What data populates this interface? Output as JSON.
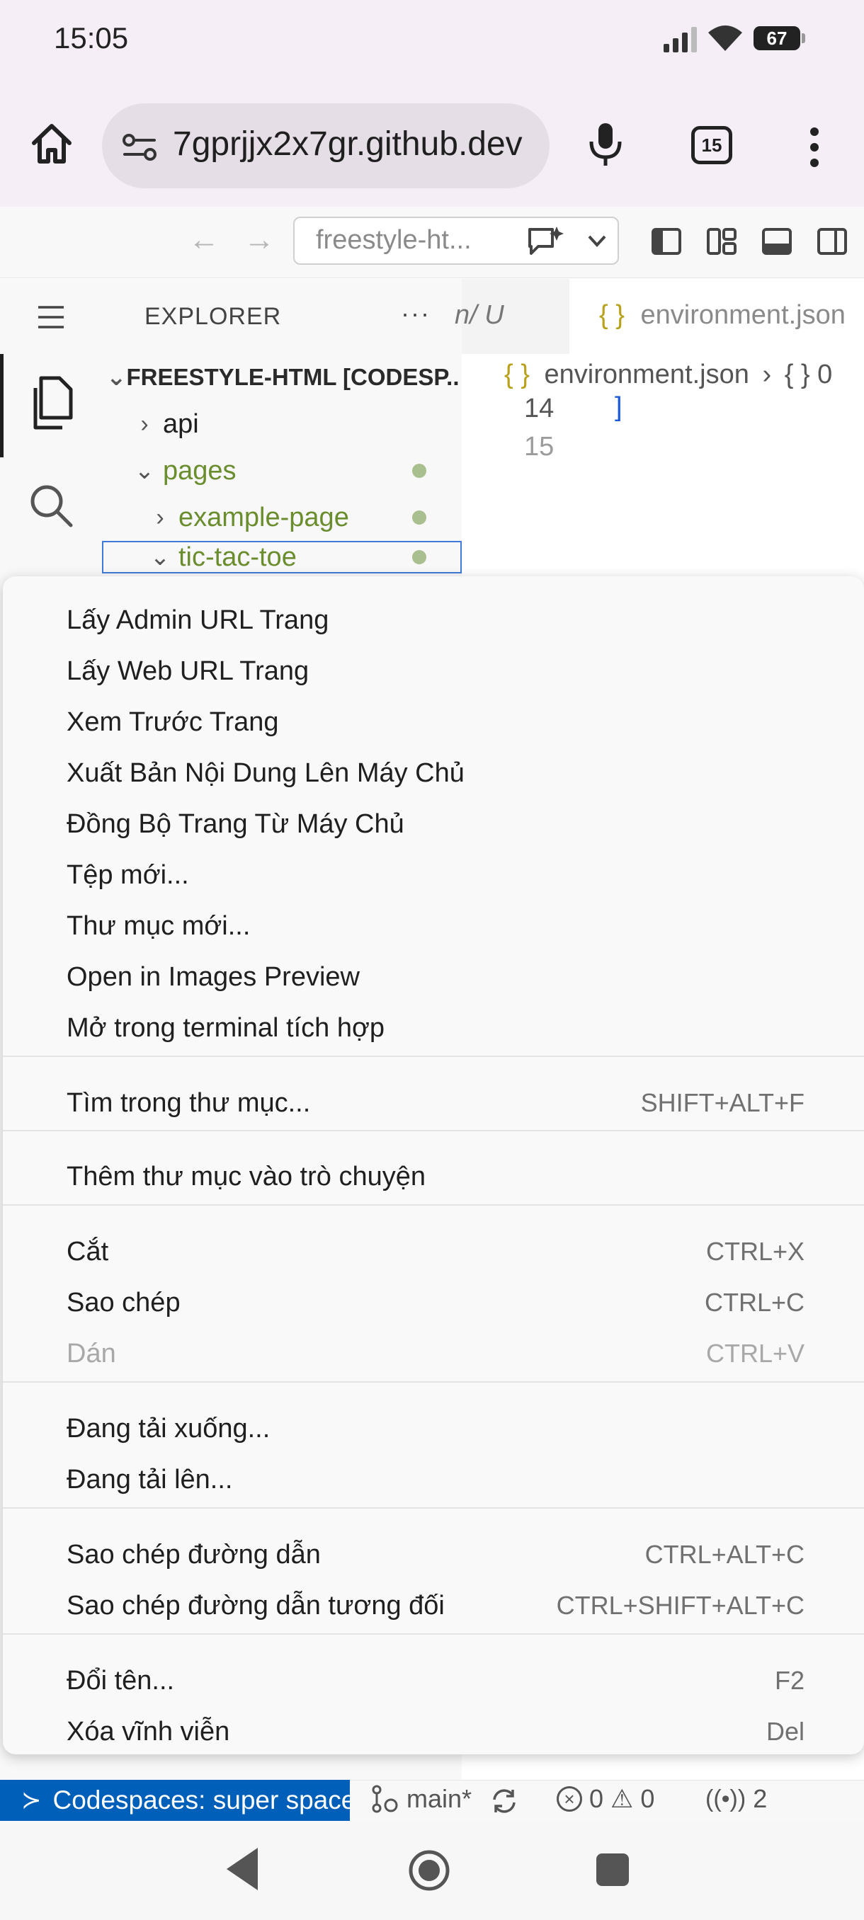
{
  "status_bar": {
    "time": "15:05",
    "battery": "67"
  },
  "browser": {
    "url": "7gprjjx2x7gr.github.dev",
    "tab_count": "15"
  },
  "vscode": {
    "command_center_text": "freestyle-ht...",
    "activity": {
      "items": [
        "menu",
        "explorer",
        "search"
      ]
    },
    "explorer": {
      "title": "EXPLORER",
      "more": "···",
      "root": "FREESTYLE-HTML [CODESP...",
      "items": [
        {
          "label": "api"
        },
        {
          "label": "pages"
        },
        {
          "label": "example-page"
        },
        {
          "label": "tic-tac-toe"
        }
      ]
    },
    "editor": {
      "left_tab_fragment": "n/ U",
      "active_tab": "environment.json",
      "breadcrumb_file": "environment.json",
      "breadcrumb_symbol": "{ } 0",
      "lines": [
        {
          "number": "14",
          "code": "]"
        },
        {
          "number": "15",
          "code": ""
        }
      ]
    },
    "context_menu": {
      "groups": [
        [
          {
            "label": "Lấy Admin URL Trang",
            "shortcut": ""
          },
          {
            "label": "Lấy Web URL Trang",
            "shortcut": ""
          },
          {
            "label": "Xem Trước Trang",
            "shortcut": ""
          },
          {
            "label": "Xuất Bản Nội Dung Lên Máy Chủ",
            "shortcut": ""
          },
          {
            "label": "Đồng Bộ Trang Từ Máy Chủ",
            "shortcut": ""
          },
          {
            "label": "Tệp mới...",
            "shortcut": ""
          },
          {
            "label": "Thư mục mới...",
            "shortcut": ""
          },
          {
            "label": "Open in Images Preview",
            "shortcut": ""
          },
          {
            "label": "Mở trong terminal tích hợp",
            "shortcut": ""
          }
        ],
        [
          {
            "label": "Tìm trong thư mục...",
            "shortcut": "SHIFT+ALT+F"
          }
        ],
        [
          {
            "label": "Thêm thư mục vào trò chuyện",
            "shortcut": ""
          }
        ],
        [
          {
            "label": "Cắt",
            "shortcut": "CTRL+X"
          },
          {
            "label": "Sao chép",
            "shortcut": "CTRL+C"
          },
          {
            "label": "Dán",
            "shortcut": "CTRL+V",
            "disabled": true
          }
        ],
        [
          {
            "label": "Đang tải xuống...",
            "shortcut": ""
          },
          {
            "label": "Đang tải lên...",
            "shortcut": ""
          }
        ],
        [
          {
            "label": "Sao chép đường dẫn",
            "shortcut": "CTRL+ALT+C"
          },
          {
            "label": "Sao chép đường dẫn tương đối",
            "shortcut": "CTRL+SHIFT+ALT+C"
          }
        ],
        [
          {
            "label": "Đổi tên...",
            "shortcut": "F2"
          },
          {
            "label": "Xóa vĩnh viễn",
            "shortcut": "Del"
          }
        ]
      ]
    },
    "status_bar": {
      "remote": "Codespaces: super space",
      "branch": "main*",
      "errors": "0",
      "warnings": "0",
      "ports": "2"
    }
  },
  "colors": {
    "accent": "#005fb8",
    "git_modified": "#6a8d2e",
    "modified_dot": "#a9bf8f",
    "selection_border": "#3f7bd6"
  }
}
